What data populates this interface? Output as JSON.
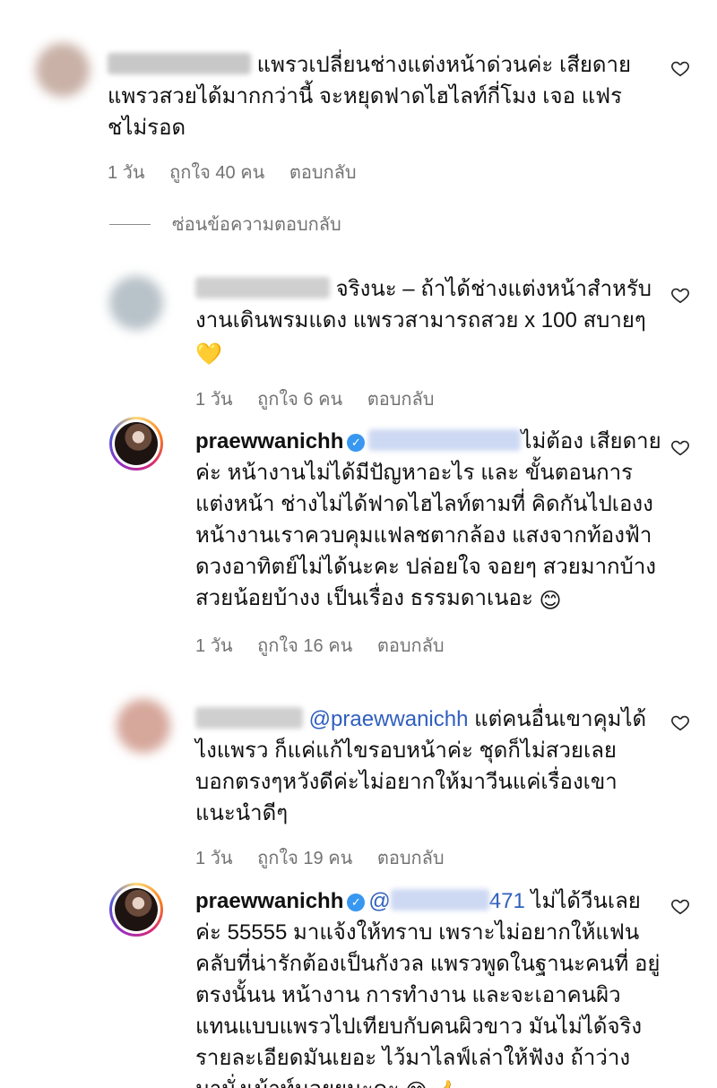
{
  "comments": [
    {
      "text": "แพรวเปลี่ยนช่างแต่งหน้าด่วนค่ะ เสียดาย แพรวสวยได้มากกว่านี้ จะหยุดฟาดไฮไลท์กี่โมง เจอ แฟรชไม่รอด",
      "time": "1 วัน",
      "likes": "ถูกใจ 40 คน",
      "reply": "ตอบกลับ"
    },
    {
      "text": "จริงนะ – ถ้าได้ช่างแต่งหน้าสำหรับ งานเดินพรมแดง แพรวสามารถสวย x 100 สบายๆ",
      "emoji": "💛",
      "time": "1 วัน",
      "likes": "ถูกใจ 6 คน",
      "reply": "ตอบกลับ"
    },
    {
      "username": "praewwanichh",
      "text": "ไม่ต้อง เสียดายค่ะ หน้างานไม่ได้มีปัญหาอะไร และ ขั้นตอนการแต่งหน้า ช่างไม่ได้ฟาดไฮไลท์ตามที่ คิดกันไปเองง หน้างานเราควบคุมแฟลชตากล้อง แสงจากท้องฟ้า ดวงอาทิตย์ไม่ได้นะคะ ปล่อยใจ จอยๆ สวยมากบ้าง สวยน้อยบ้างง เป็นเรื่อง ธรรมดาเนอะ",
      "emoji": "😊",
      "time": "1 วัน",
      "likes": "ถูกใจ 16 คน",
      "reply": "ตอบกลับ"
    },
    {
      "mention": "@praewwanichh",
      "text": "แต่คนอื่นเขาคุมได้ ไงแพรว ก็แค่แก้ไขรอบหน้าค่ะ ชุดก็ไม่สวยเลย บอกตรงๆหวังดีค่ะไม่อยากให้มาวีนแค่เรื่องเขา แนะนำดีๆ",
      "time": "1 วัน",
      "likes": "ถูกใจ 19 คน",
      "reply": "ตอบกลับ"
    },
    {
      "username": "praewwanichh",
      "mention_partial": "@",
      "mention_tail": "471",
      "text": "ไม่ได้วีนเลยค่ะ 55555 มาแจ้งให้ทราบ เพราะไม่อยากให้แฟน คลับที่น่ารักต้องเป็นกังวล แพรวพูดในฐานะคนที่ อยู่ตรงนั้นน หน้างาน การทำงาน และจะเอาคนผิว แทนแบบแพรวไปเทียบกับคนผิวขาว มันไม่ได้จริง รายละเอียดมันเยอะ ไว้มาไลฟ์เล่าให้ฟังง ถ้าว่าง มานั่งเม้าท์มอยยนะคะ",
      "emoji": "😊 👍"
    }
  ],
  "hide_replies": "ซ่อนข้อความตอบกลับ",
  "colors": {
    "meta": "#737373",
    "mention": "#2f5fbf",
    "verified": "#3897f0"
  }
}
